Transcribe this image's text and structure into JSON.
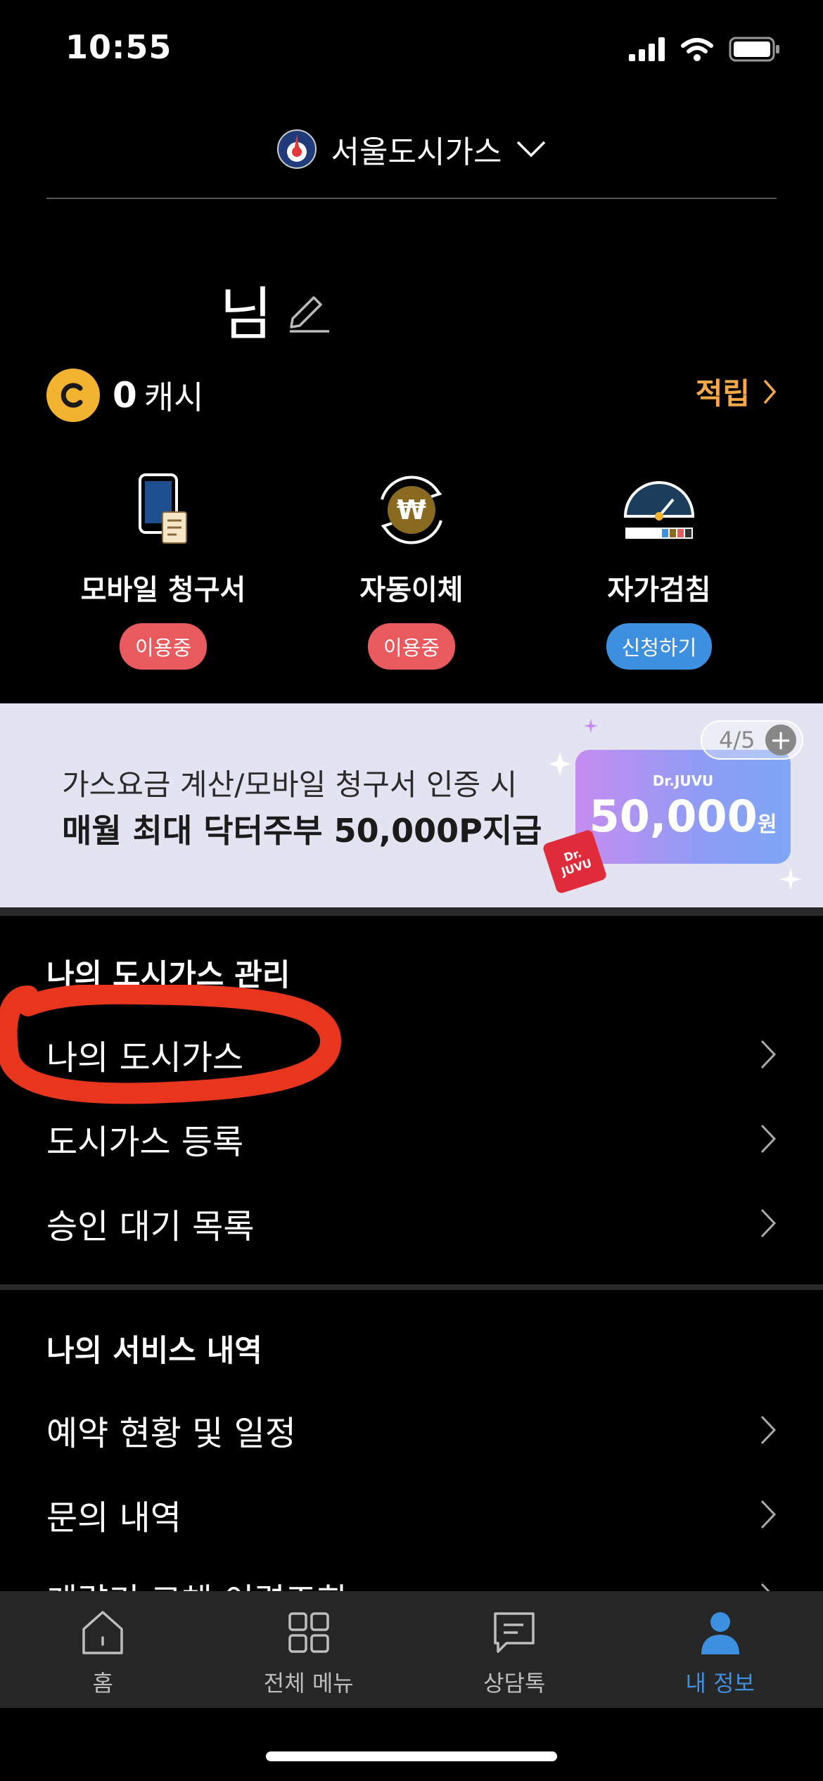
{
  "status_bar": {
    "time": "10:55"
  },
  "provider": {
    "name": "서울도시가스"
  },
  "user": {
    "name_suffix": "님"
  },
  "cash": {
    "coin_letter": "C",
    "amount": "0",
    "unit": "캐시",
    "earn_label": "적립"
  },
  "services": [
    {
      "label": "모바일 청구서",
      "status": "이용중",
      "status_color": "#e85a5d"
    },
    {
      "label": "자동이체",
      "status": "이용중",
      "status_color": "#e85a5d"
    },
    {
      "label": "자가검침",
      "status": "신청하기",
      "status_color": "#3d8fe0"
    }
  ],
  "banner": {
    "line1": "가스요금 계산/모바일 청구서 인증 시",
    "line2": "매월 최대 닥터주부 50,000P지급",
    "ticket_brand": "Dr.JUVU",
    "ticket_amount": "50,000",
    "ticket_unit": "원",
    "stamp_line1": "Dr.",
    "stamp_line2": "JUVU",
    "pager": "4/5"
  },
  "sections": [
    {
      "title": "나의 도시가스 관리",
      "items": [
        "나의 도시가스",
        "도시가스 등록",
        "승인 대기 목록"
      ]
    },
    {
      "title": "나의 서비스 내역",
      "items": [
        "예약 현황 및 일정",
        "문의 내역",
        "계량기 교체 이력조회"
      ]
    }
  ],
  "tabs": [
    {
      "label": "홈",
      "icon": "home-icon"
    },
    {
      "label": "전체 메뉴",
      "icon": "grid-icon"
    },
    {
      "label": "상담톡",
      "icon": "chat-icon"
    },
    {
      "label": "내 정보",
      "icon": "person-icon",
      "active": true
    }
  ],
  "colors": {
    "accent": "#3d8fe0",
    "earn": "#f5a94a",
    "coin": "#f2b331",
    "annotation": "#e8351e"
  }
}
